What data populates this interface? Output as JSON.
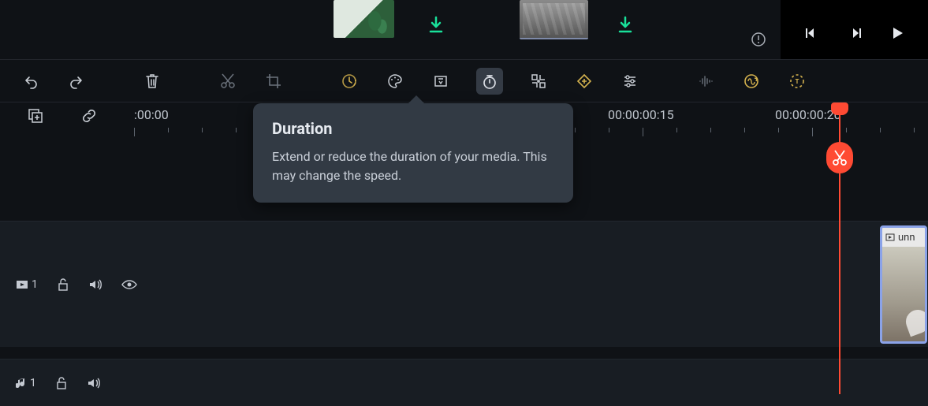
{
  "tooltip": {
    "title": "Duration",
    "body": "Extend or reduce the duration of your media. This may change the speed."
  },
  "ruler": {
    "start_label": ":00:00",
    "label_15": "00:00:00:15",
    "label_20": "00:00:00:20"
  },
  "tracks": {
    "video": {
      "index": "1"
    },
    "audio": {
      "index": "1"
    }
  },
  "clip": {
    "label": "unn"
  },
  "toolbar_icons": [
    "undo",
    "redo",
    "delete",
    "cut",
    "crop",
    "speed",
    "color",
    "mask",
    "duration",
    "smart-cut",
    "keyframe",
    "adjust",
    "audio-wave",
    "audio-stretch",
    "text-anim"
  ]
}
